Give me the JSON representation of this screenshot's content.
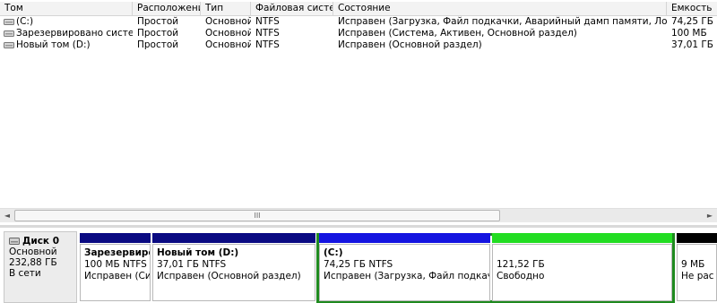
{
  "columns": [
    "Том",
    "Расположение",
    "Тип",
    "Файловая система",
    "Состояние",
    "Емкость"
  ],
  "volumes": [
    {
      "name": "(C:)",
      "layout": "Простой",
      "type": "Основной",
      "fs": "NTFS",
      "status": "Исправен (Загрузка, Файл подкачки, Аварийный дамп памяти, Логический диск)",
      "capacity": "74,25 ГБ"
    },
    {
      "name": "Зарезервировано системой",
      "layout": "Простой",
      "type": "Основной",
      "fs": "NTFS",
      "status": "Исправен (Система, Активен, Основной раздел)",
      "capacity": "100 МБ"
    },
    {
      "name": "Новый том (D:)",
      "layout": "Простой",
      "type": "Основной",
      "fs": "NTFS",
      "status": "Исправен (Основной раздел)",
      "capacity": "37,01 ГБ"
    }
  ],
  "scrollbar": {
    "thumb_grip": "III",
    "left_arrow": "◄",
    "right_arrow": "►"
  },
  "disk": {
    "title": "Диск 0",
    "kind": "Основной",
    "size": "232,88 ГБ",
    "state": "В сети"
  },
  "partitions": [
    {
      "name": "Зарезервиров",
      "size": "100 МБ NTFS",
      "status": "Исправен (Сис",
      "bar_color": "#0a0a82"
    },
    {
      "name": "Новый том  (D:)",
      "size": "37,01 ГБ NTFS",
      "status": "Исправен (Основной раздел)",
      "bar_color": "#0a0a82"
    },
    {
      "name": "(C:)",
      "size": "74,25 ГБ NTFS",
      "status": "Исправен (Загрузка, Файл подкачки, Ава",
      "bar_color": "#1414e0"
    },
    {
      "name": "",
      "size": "121,52 ГБ",
      "status": "Свободно",
      "bar_color": "#22dd22"
    },
    {
      "name": "",
      "size": "9 МБ",
      "status": "Не рас",
      "bar_color": "#000000"
    }
  ]
}
